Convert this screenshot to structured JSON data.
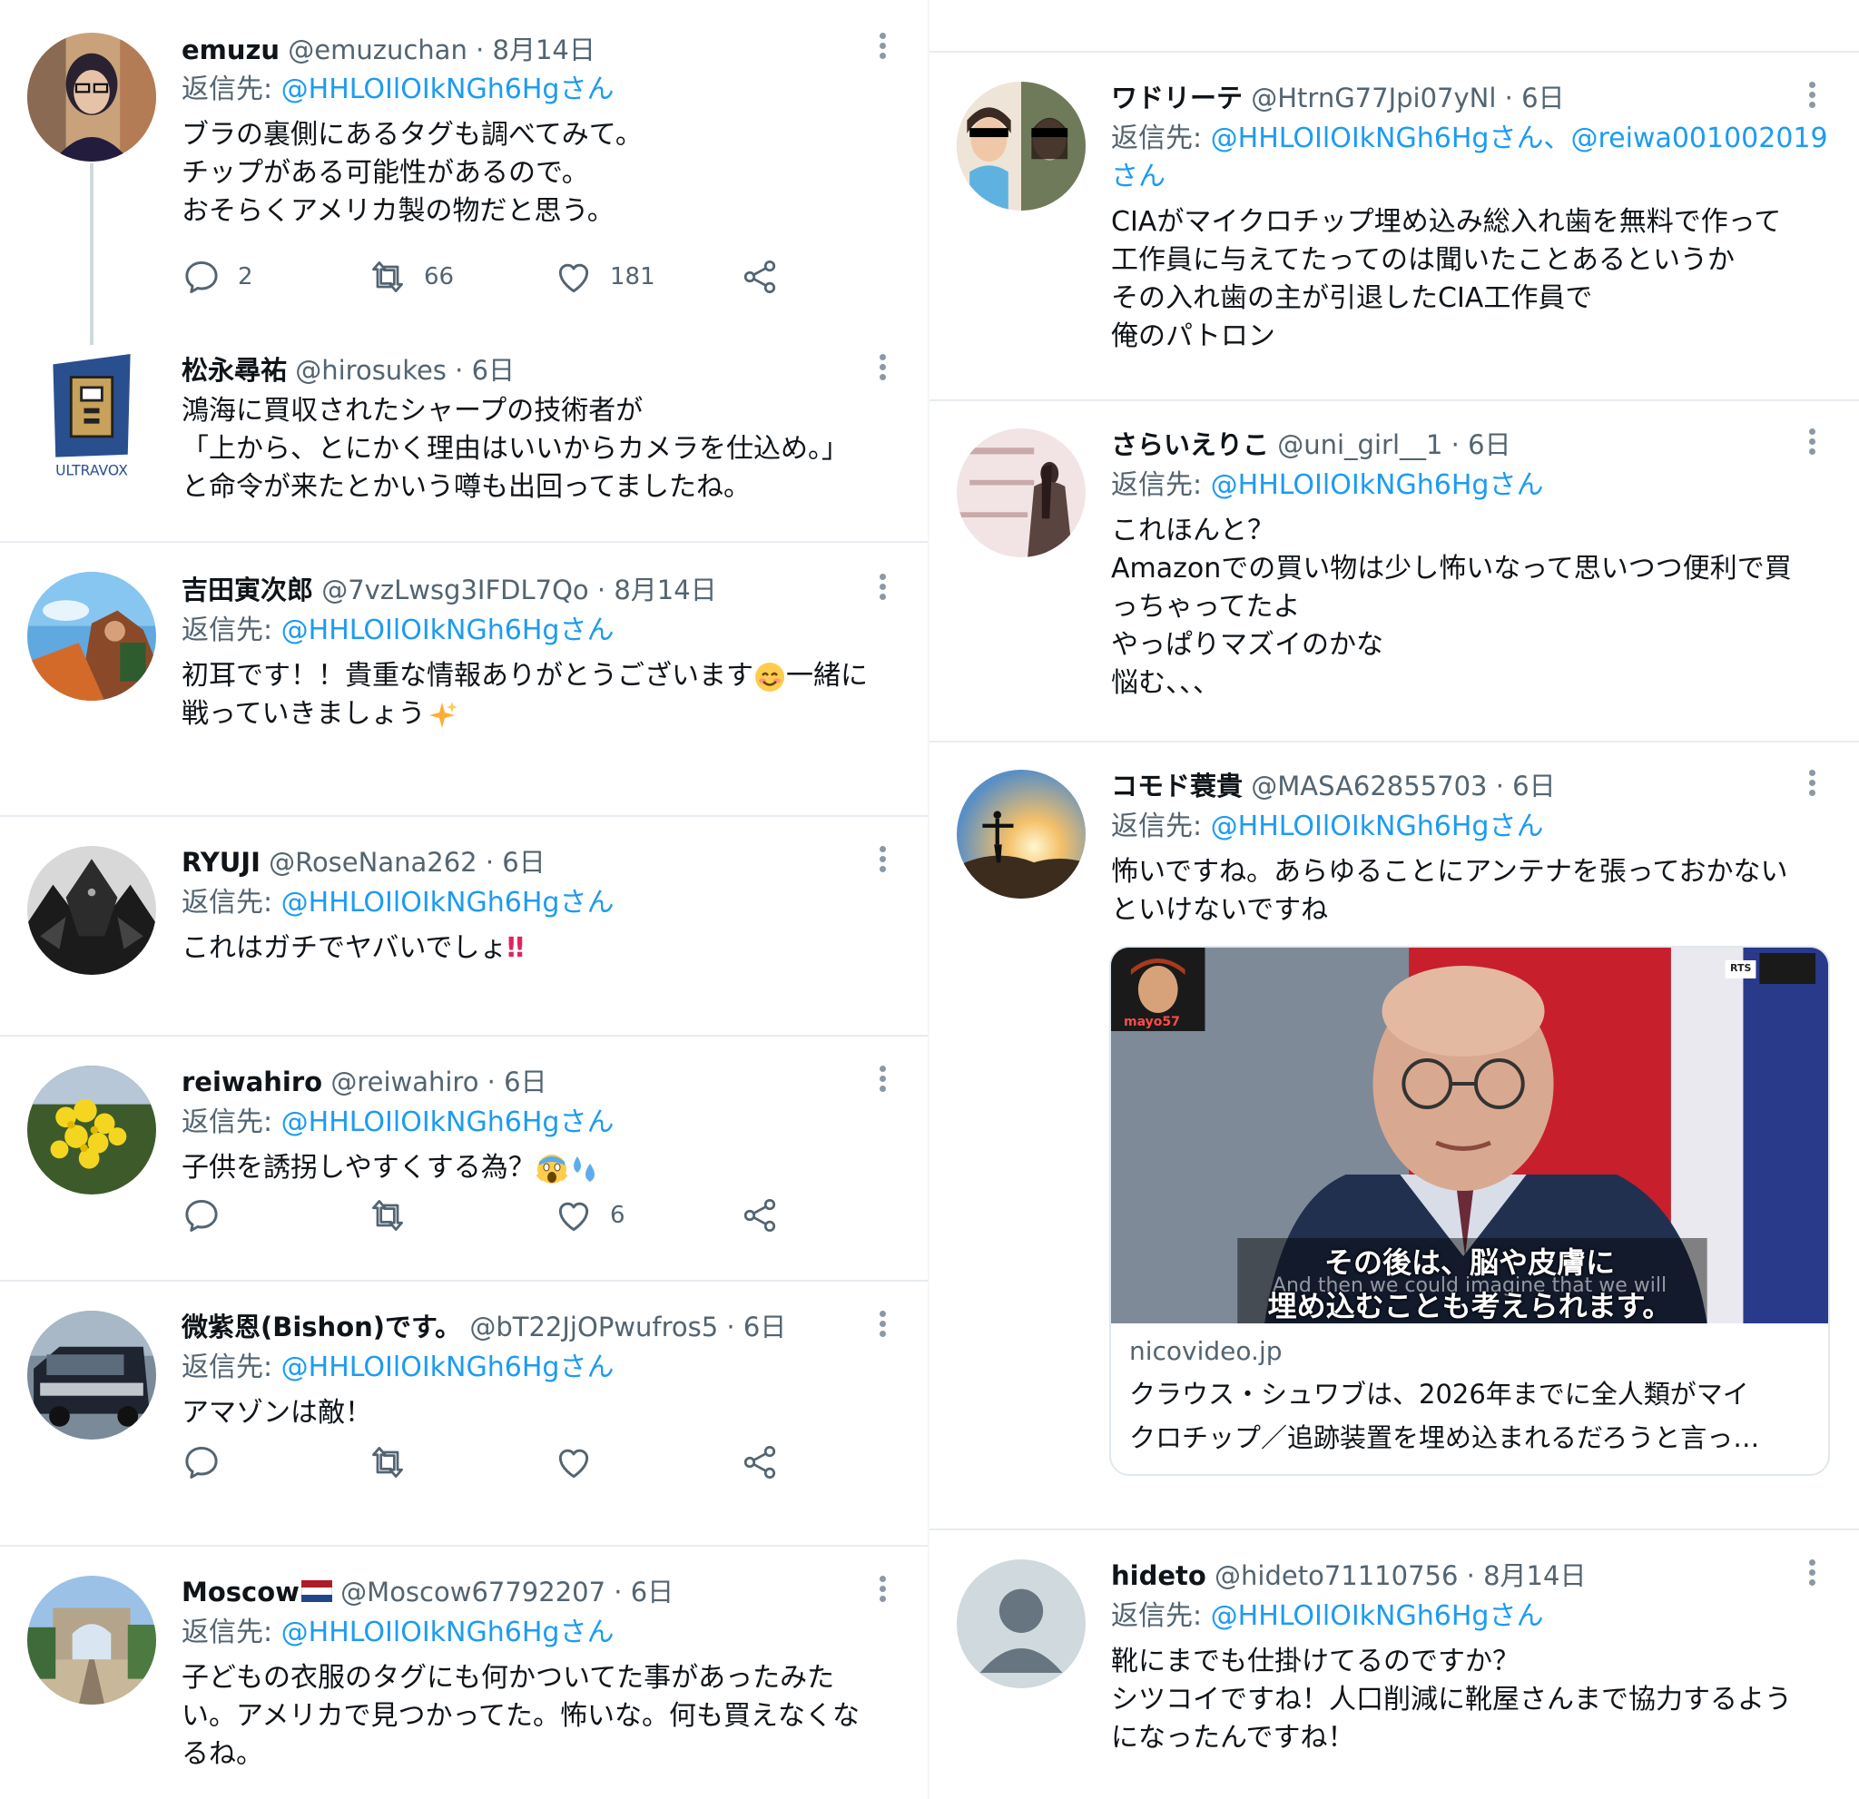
{
  "colors": {
    "link": "#1d9bf0",
    "muted": "#536471",
    "text": "#0f1419",
    "divider": "#e7ecf0"
  },
  "left_column": {
    "tweets": [
      {
        "name": "emuzu",
        "handle": "@emuzuchan",
        "separator": "·",
        "time": "8月14日",
        "reply_prefix": "返信先: ",
        "reply_to": "@HHLOIlOIkNGh6Hgさん",
        "lines": [
          "ブラの裏側にあるタグも調べてみて。",
          "チップがある可能性があるので。",
          "おそらくアメリカ製の物だと思う。"
        ],
        "replies": "2",
        "retweets": "66",
        "likes": "181"
      },
      {
        "name": "松永尋祐",
        "handle": "@hirosukes",
        "separator": "·",
        "time": "6日",
        "avatar_text": "ULTRAVOX",
        "lines": [
          "鴻海に買収されたシャープの技術者が",
          "「上から、とにかく理由はいいからカメラを仕込め。」",
          "と命令が来たとかいう噂も出回ってましたね。"
        ]
      },
      {
        "name": "吉田寅次郎",
        "handle": "@7vzLwsg3IFDL7Qo",
        "separator": "·",
        "time": "8月14日",
        "reply_prefix": "返信先: ",
        "reply_to": "@HHLOIlOIkNGh6Hgさん",
        "line1_a": "初耳です！！貴重な情報ありがとうございます",
        "line1_b": "一緒に",
        "line2": "戦っていきましょう",
        "emoji_1": "smiling-face-emoji",
        "emoji_2": "sparkles-emoji"
      },
      {
        "name": "RYUJI",
        "handle": "@RoseNana262",
        "separator": "·",
        "time": "6日",
        "reply_prefix": "返信先: ",
        "reply_to": "@HHLOIlOIkNGh6Hgさん",
        "line1": "これはガチでヤバいでしょ",
        "emoji_1": "double-exclamation-emoji",
        "emoji_1_text": "‼"
      },
      {
        "name": "reiwahiro",
        "handle": "@reiwahiro",
        "separator": "·",
        "time": "6日",
        "reply_prefix": "返信先: ",
        "reply_to": "@HHLOIlOIkNGh6Hgさん",
        "line1": "子供を誘拐しやすくする為？",
        "emoji_1": "screaming-face-emoji",
        "emoji_2": "sweat-droplets-emoji",
        "likes": "6"
      },
      {
        "name": "微紫恩(Bishon)です。",
        "handle": "@bT22JjOPwufros5",
        "separator": "·",
        "time": "6日",
        "reply_prefix": "返信先: ",
        "reply_to": "@HHLOIlOIkNGh6Hgさん",
        "line1": "アマゾンは敵！"
      },
      {
        "name": "Moscow",
        "flag": "netherlands-flag",
        "handle": "@Moscow67792207",
        "separator": "·",
        "time": "6日",
        "reply_prefix": "返信先: ",
        "reply_to": "@HHLOIlOIkNGh6Hgさん",
        "lines": [
          "子どもの衣服のタグにも何かついてた事があったみた",
          "い。アメリカで見つかってた。怖いな。何も買えなくな",
          "るね。"
        ]
      }
    ]
  },
  "right_column": {
    "tweets": [
      {
        "name": "ワドリーテ",
        "handle": "@HtrnG77Jpi07yNl",
        "separator": "·",
        "time": "6日",
        "reply_prefix": "返信先: ",
        "reply_to": "@HHLOIlOIkNGh6Hgさん、@reiwa001002019",
        "reply_to_2": "さん",
        "lines": [
          "CIAがマイクロチップ埋め込み総入れ歯を無料で作って",
          "工作員に与えてたってのは聞いたことあるというか",
          "その入れ歯の主が引退したCIA工作員で",
          "俺のパトロン"
        ]
      },
      {
        "name": "さらいえりこ",
        "handle": "@uni_girl__1",
        "separator": "·",
        "time": "6日",
        "reply_prefix": "返信先: ",
        "reply_to": "@HHLOIlOIkNGh6Hgさん",
        "lines": [
          "これほんと？",
          "Amazonでの買い物は少し怖いなって思いつつ便利で買",
          "っちゃってたよ",
          "やっぱりマズイのかな",
          "悩む、、、"
        ]
      },
      {
        "name": "コモド蓑貴",
        "handle": "@MASA62855703",
        "separator": "·",
        "time": "6日",
        "reply_prefix": "返信先: ",
        "reply_to": "@HHLOIlOIkNGh6Hgさん",
        "lines": [
          "怖いですね。あらゆることにアンテナを張っておかない",
          "といけないですね"
        ],
        "card": {
          "subtitle_1": "その後は、脳や皮膚に",
          "subtitle_2": "埋め込むことも考えられます。",
          "subtitle_en": "And then we could imagine that we will",
          "corner_badge": "RTS",
          "inset_label": "mayo57",
          "domain": "nicovideo.jp",
          "title_1": "クラウス・シュワブは、2026年までに全人類がマイ",
          "title_2": "クロチップ／追跡装置を埋め込まれるだろうと言っ…"
        }
      },
      {
        "name": "hideto",
        "handle": "@hideto71110756",
        "separator": "·",
        "time": "8月14日",
        "reply_prefix": "返信先: ",
        "reply_to": "@HHLOIlOIkNGh6Hgさん",
        "lines": [
          "靴にまでも仕掛けてるのですか？",
          "シツコイですね！人口削減に靴屋さんまで協力するよう",
          "になったんですね！"
        ]
      }
    ]
  },
  "icons": {
    "reply": "reply-icon",
    "retweet": "retweet-icon",
    "like": "heart-icon",
    "share": "share-icon",
    "more": "more-vertical-icon"
  }
}
